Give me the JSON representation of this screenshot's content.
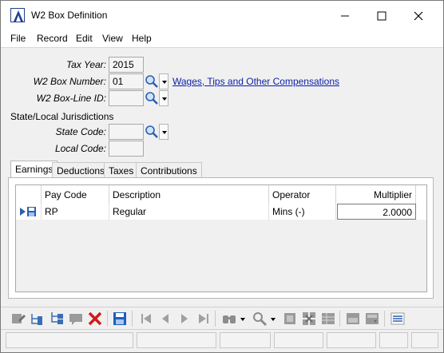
{
  "window": {
    "title": "W2 Box Definition",
    "controls": [
      "minimize-icon",
      "maximize-icon",
      "close-icon"
    ]
  },
  "menu": [
    "File",
    "Record",
    "Edit",
    "View",
    "Help"
  ],
  "form": {
    "tax_year_label": "Tax Year:",
    "tax_year_value": "2015",
    "box_number_label": "W2 Box Number:",
    "box_number_value": "01",
    "box_number_desc": "Wages, Tips and Other Compensations",
    "box_line_label": "W2  Box-Line ID:",
    "box_line_value": "",
    "state_local_header": "State/Local Jurisdictions",
    "state_code_label": "State Code:",
    "state_code_value": "",
    "local_code_label": "Local Code:",
    "local_code_value": ""
  },
  "tabs": [
    "Earnings",
    "Deductions",
    "Taxes",
    "Contributions"
  ],
  "active_tab": "Earnings",
  "grid": {
    "columns": [
      "Pay Code",
      "Description",
      "Operator",
      "Multiplier"
    ],
    "rows": [
      {
        "pay_code": "RP",
        "description": "Regular",
        "operator": "Mins (-)",
        "multiplier": "2.0000"
      }
    ]
  },
  "toolbar_icons": [
    "edit-note-icon",
    "tree-add-icon",
    "tree-branch-icon",
    "comment-icon",
    "delete-icon",
    "save-icon",
    "first-record-icon",
    "previous-record-icon",
    "next-record-icon",
    "last-record-icon",
    "find-icon",
    "zoom-icon",
    "grid-a-icon",
    "grid-b-icon",
    "grid-c-icon",
    "form-a-icon",
    "form-b-icon",
    "list-icon"
  ],
  "colors": {
    "link": "#0b1ea8",
    "delete": "#d11a1a",
    "save": "#1e5fbf",
    "accent": "#2b5fae"
  }
}
